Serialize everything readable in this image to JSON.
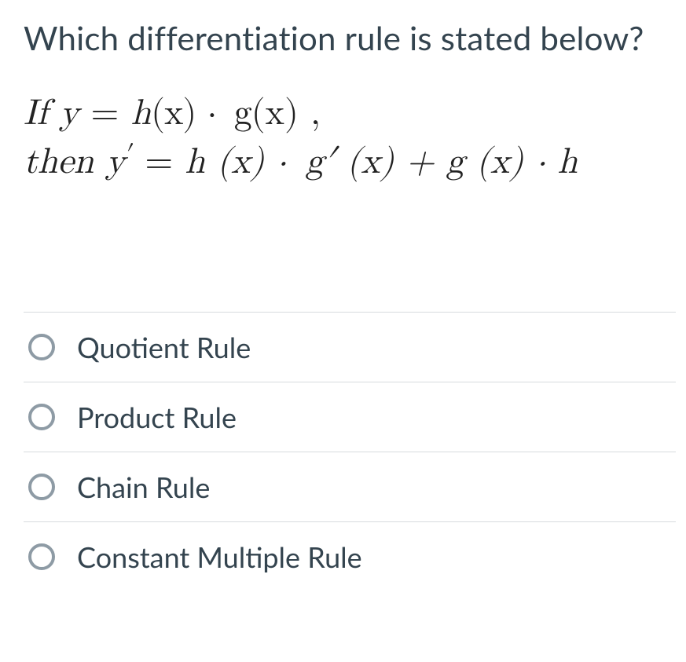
{
  "question": "Which differentiation rule is stated below?",
  "formula": {
    "line1_prefix": "If y",
    "line1_eq": " = ",
    "line1_rhs_a": "h",
    "line1_rhs_b": "(x) ·  g",
    "line1_rhs_c": "(x) ,",
    "line2_prefix": "then y",
    "line2_prime": "′",
    "line2_eq": " = ",
    "line2_rhs": "h (x) ·  g′ (x) + g (x) · h"
  },
  "options": [
    {
      "label": "Quotient Rule"
    },
    {
      "label": "Product Rule"
    },
    {
      "label": "Chain Rule"
    },
    {
      "label": "Constant Multiple Rule"
    }
  ]
}
